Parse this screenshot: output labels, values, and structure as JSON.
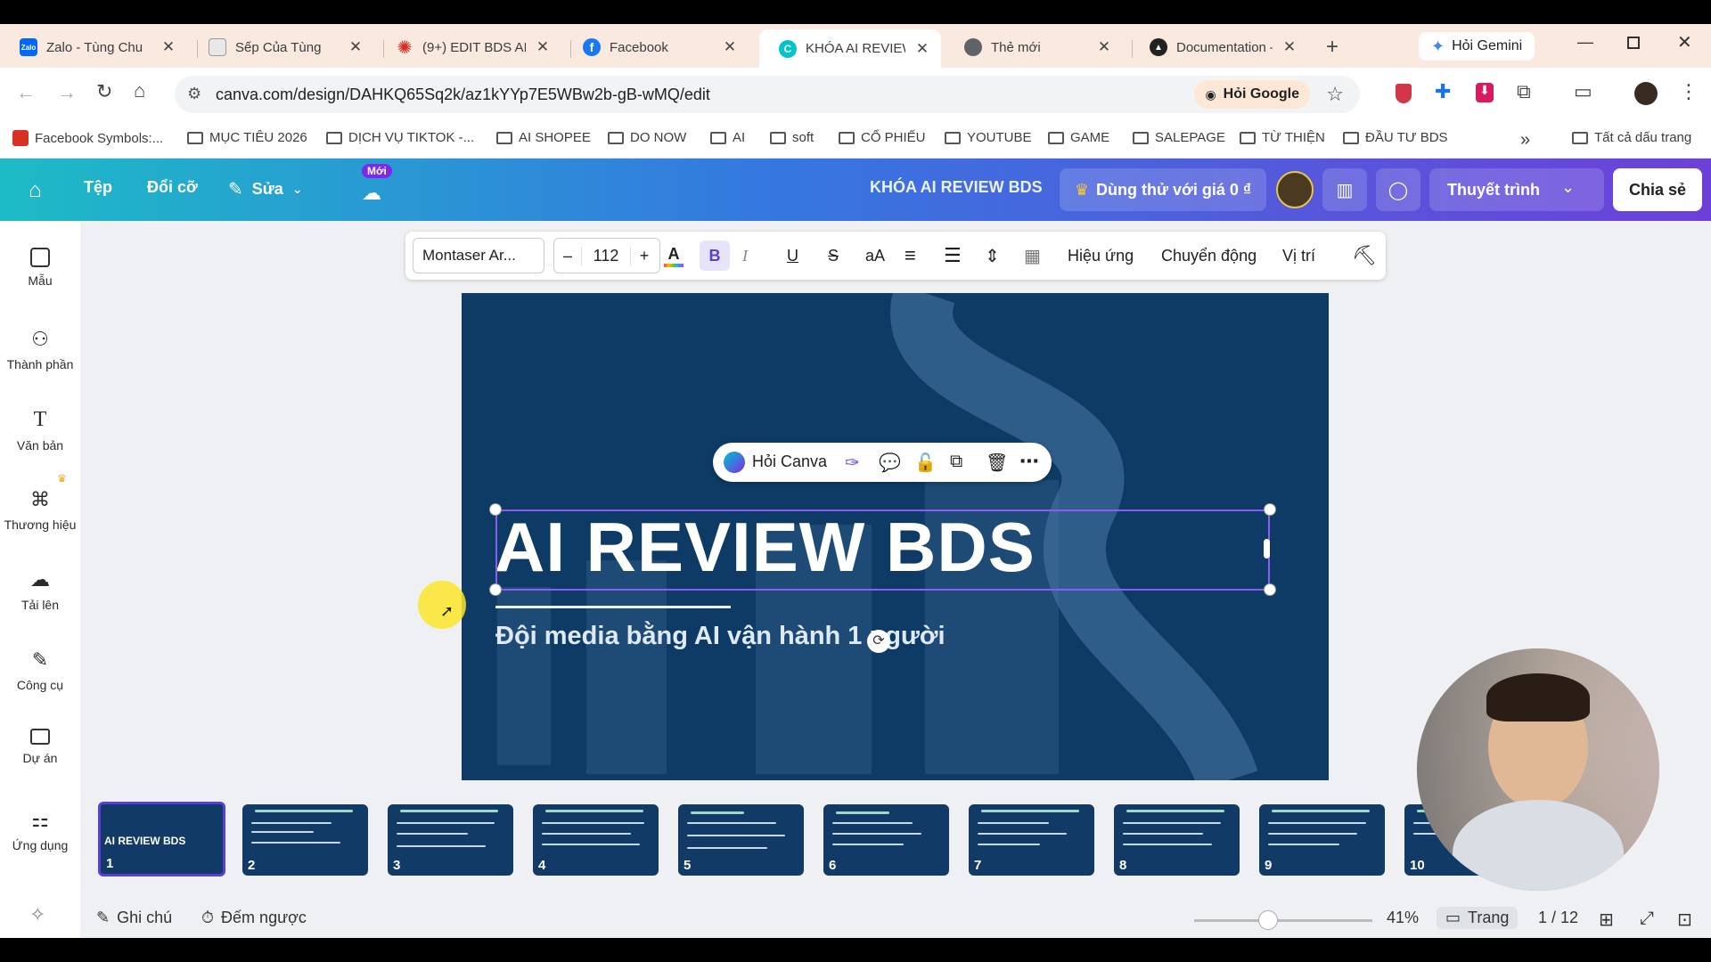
{
  "tabs": [
    {
      "title": "Zalo - Tùng Chu",
      "icon": "zalo-icon",
      "color": "#0068ff",
      "short": "Zalo"
    },
    {
      "title": "Sếp Của Tùng",
      "icon": "document-icon",
      "color": "#9aa0a6",
      "short": ""
    },
    {
      "title": "(9+) EDIT BDS AI |",
      "icon": "burst-icon",
      "color": "#d93025",
      "short": ""
    },
    {
      "title": "Facebook",
      "icon": "facebook-icon",
      "color": "#1877f2",
      "short": "f"
    },
    {
      "title": "KHÓA AI REVIEW",
      "icon": "canva-icon",
      "color": "#00c4cc",
      "short": "C"
    },
    {
      "title": "Thẻ mới",
      "icon": "chrome-icon",
      "color": "#5f6368",
      "short": ""
    },
    {
      "title": "Documentation –",
      "icon": "notion-icon",
      "color": "#222222",
      "short": ""
    }
  ],
  "new_tab_symbol": "+",
  "gemini_label": "Hỏi Gemini",
  "url": "canva.com/design/DAHKQ65Sq2k/az1kYYp7E5WBw2b-gB-wMQ/edit",
  "hoi_google": "Hỏi Google",
  "bookmarks": [
    "Facebook Symbols:...",
    "MỤC TIÊU 2026",
    "DỊCH VỤ TIKTOK -...",
    "AI SHOPEE",
    "DO NOW",
    "AI",
    "soft",
    "CỔ PHIẾU",
    "YOUTUBE",
    "GAME",
    "SALEPAGE",
    "TỪ THIỆN",
    "ĐẦU TƯ BDS"
  ],
  "bookmarks_more": "»",
  "all_bookmarks": "Tất cả dấu trang",
  "canva": {
    "menu": {
      "file": "Tệp",
      "resize": "Đổi cỡ",
      "edit": "Sửa",
      "new_badge": "Mới"
    },
    "doc_title": "KHÓA AI REVIEW BDS",
    "trial": "Dùng thử với giá 0 ₫",
    "present": "Thuyết trình",
    "share": "Chia sẻ"
  },
  "sidebar": [
    {
      "label": "Mẫu",
      "icon": "template-icon"
    },
    {
      "label": "Thành phần",
      "icon": "elements-icon"
    },
    {
      "label": "Văn bản",
      "icon": "text-icon"
    },
    {
      "label": "Thương hiệu",
      "icon": "brand-icon"
    },
    {
      "label": "Tải lên",
      "icon": "upload-icon"
    },
    {
      "label": "Công cụ",
      "icon": "tools-icon"
    },
    {
      "label": "Dự án",
      "icon": "folder-icon"
    },
    {
      "label": "Ứng dụng",
      "icon": "apps-icon"
    }
  ],
  "format_bar": {
    "font": "Montaser Ar...",
    "minus": "–",
    "size": "112",
    "plus": "+",
    "case": "aA",
    "effects": "Hiệu ứng",
    "animate": "Chuyển động",
    "position": "Vị trí"
  },
  "context_menu": {
    "ask": "Hỏi Canva"
  },
  "slide": {
    "title": "AI REVIEW BDS",
    "subtitle": "Đội media bằng AI vận hành 1 người"
  },
  "thumbnails": [
    {
      "num": "1",
      "title": "AI REVIEW BDS"
    },
    {
      "num": "2"
    },
    {
      "num": "3"
    },
    {
      "num": "4"
    },
    {
      "num": "5"
    },
    {
      "num": "6"
    },
    {
      "num": "7"
    },
    {
      "num": "8"
    },
    {
      "num": "9"
    },
    {
      "num": "10"
    }
  ],
  "bottom": {
    "notes": "Ghi chú",
    "timer": "Đếm ngược",
    "zoom": "41%",
    "pages_label": "Trang",
    "page_count": "1 / 12"
  }
}
